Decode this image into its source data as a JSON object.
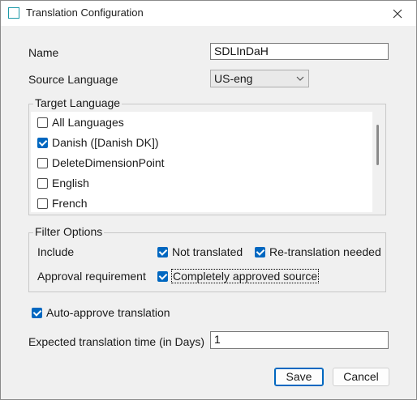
{
  "window": {
    "title": "Translation Configuration",
    "accent_color": "#0067c0"
  },
  "form": {
    "name_label": "Name",
    "name_value": "SDLInDaH",
    "source_language_label": "Source Language",
    "source_language_value": "US-eng",
    "expected_time_label": "Expected translation time (in Days)",
    "expected_time_value": "1"
  },
  "target_language": {
    "title": "Target Language",
    "items": [
      {
        "label": "All Languages",
        "checked": false
      },
      {
        "label": "Danish ([Danish DK])",
        "checked": true
      },
      {
        "label": "DeleteDimensionPoint",
        "checked": false
      },
      {
        "label": "English",
        "checked": false
      },
      {
        "label": "French",
        "checked": false
      }
    ]
  },
  "filter_options": {
    "title": "Filter Options",
    "include_label": "Include",
    "not_translated_label": "Not translated",
    "not_translated_checked": true,
    "retranslation_label": "Re-translation needed",
    "retranslation_checked": true,
    "approval_label": "Approval requirement",
    "completely_approved_label": "Completely approved source",
    "completely_approved_checked": true
  },
  "auto_approve": {
    "label": "Auto-approve translation",
    "checked": true
  },
  "buttons": {
    "save": "Save",
    "cancel": "Cancel"
  }
}
